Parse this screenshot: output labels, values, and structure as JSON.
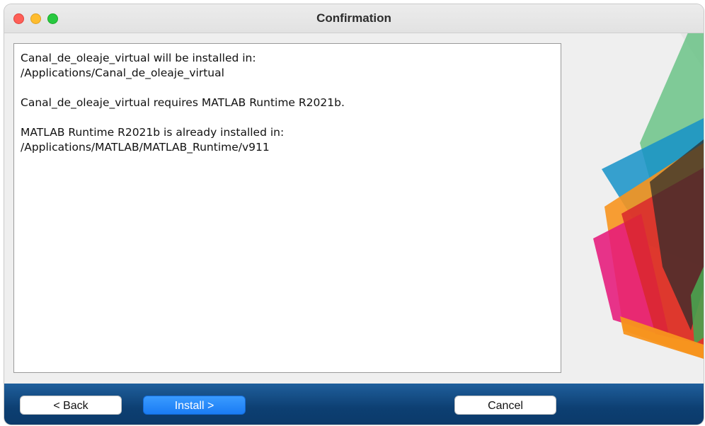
{
  "window": {
    "title": "Confirmation"
  },
  "message": {
    "line1": "Canal_de_oleaje_virtual will be installed in:",
    "line2": "/Applications/Canal_de_oleaje_virtual",
    "line3": "Canal_de_oleaje_virtual requires MATLAB Runtime R2021b.",
    "line4": "MATLAB Runtime R2021b is already installed in:",
    "line5": "/Applications/MATLAB/MATLAB_Runtime/v911"
  },
  "buttons": {
    "back": "< Back",
    "install": "Install >",
    "cancel": "Cancel"
  },
  "colors": {
    "footer": "#0d3f72",
    "primary_button": "#1a7cf4",
    "close": "#fe5f57",
    "minimize": "#febc2e",
    "maximize": "#28c840"
  },
  "icons": {
    "close": "window-close-icon",
    "minimize": "window-minimize-icon",
    "maximize": "window-maximize-icon",
    "decoration": "matlab-membrane-graphic"
  }
}
